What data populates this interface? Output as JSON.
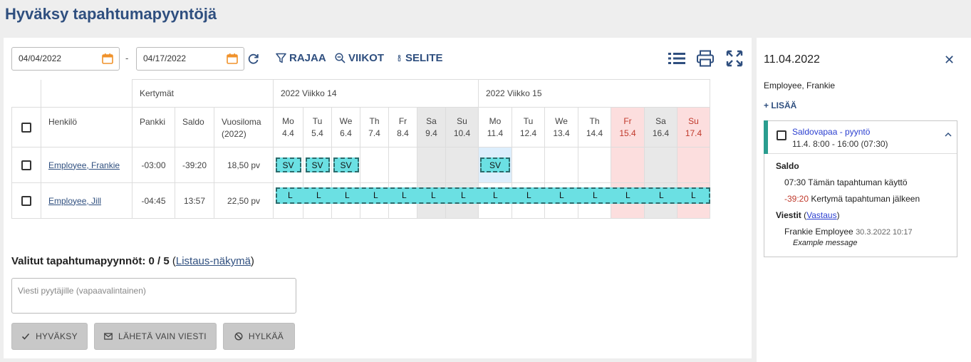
{
  "page": {
    "title": "Hyväksy tapahtumapyyntöjä"
  },
  "toolbar": {
    "date_from": "04/04/2022",
    "date_to": "04/17/2022",
    "separator": "-",
    "filter_label": "RAJAA",
    "weeks_label": "VIIKOT",
    "legend_label": "SELITE"
  },
  "grid": {
    "accruals_header": "Kertymät",
    "weeks": [
      "2022 Viikko 14",
      "2022 Viikko 15"
    ],
    "col_person": "Henkilö",
    "col_bank": "Pankki",
    "col_balance": "Saldo",
    "col_vacation": "Vuosiloma",
    "col_vacation_year": "(2022)",
    "days": [
      {
        "name": "Mo",
        "date": "4.4",
        "type": "weekday"
      },
      {
        "name": "Tu",
        "date": "5.4",
        "type": "weekday"
      },
      {
        "name": "We",
        "date": "6.4",
        "type": "weekday"
      },
      {
        "name": "Th",
        "date": "7.4",
        "type": "weekday"
      },
      {
        "name": "Fr",
        "date": "8.4",
        "type": "weekday"
      },
      {
        "name": "Sa",
        "date": "9.4",
        "type": "weekend"
      },
      {
        "name": "Su",
        "date": "10.4",
        "type": "weekend"
      },
      {
        "name": "Mo",
        "date": "11.4",
        "type": "weekday"
      },
      {
        "name": "Tu",
        "date": "12.4",
        "type": "weekday"
      },
      {
        "name": "We",
        "date": "13.4",
        "type": "weekday"
      },
      {
        "name": "Th",
        "date": "14.4",
        "type": "weekday"
      },
      {
        "name": "Fr",
        "date": "15.4",
        "type": "holiday"
      },
      {
        "name": "Sa",
        "date": "16.4",
        "type": "weekend"
      },
      {
        "name": "Su",
        "date": "17.4",
        "type": "holiday"
      }
    ],
    "rows": [
      {
        "name": "Employee, Frankie",
        "bank": "-03:00",
        "balance": "-39:20",
        "vacation": "18,50 pv",
        "event_code": "SV"
      },
      {
        "name": "Employee, Jill",
        "bank": "-04:45",
        "balance": "13:57",
        "vacation": "22,50 pv",
        "event_code": "L"
      }
    ]
  },
  "selection": {
    "label": "Valitut tapahtumapyynnöt:",
    "count": "0 / 5",
    "list_link": "Listaus-näkymä"
  },
  "message": {
    "placeholder": "Viesti pyytäjille (vapaavalintainen)"
  },
  "actions": {
    "approve": "HYVÄKSY",
    "send_message_only": "LÄHETÄ VAIN VIESTI",
    "reject": "HYLKÄÄ"
  },
  "side": {
    "date": "11.04.2022",
    "close": "✕",
    "employee": "Employee, Frankie",
    "add": "+ LISÄÄ",
    "card": {
      "title": "Saldovapaa - pyyntö",
      "time": "11.4. 8:00 - 16:00 (07:30)",
      "balance_heading": "Saldo",
      "usage_value": "07:30",
      "usage_label": "Tämän tapahtuman käyttö",
      "after_value": "-39:20",
      "after_label": "Kertymä tapahtuman jälkeen",
      "messages_heading": "Viestit",
      "reply_link": "Vastaus",
      "msg_author": "Frankie Employee",
      "msg_time": "30.3.2022 10:17",
      "msg_text": "Example message"
    }
  },
  "colors": {
    "accent": "#2f4f7f",
    "event": "#6be0e3",
    "weekend": "#e8e8e8",
    "holiday": "#fcdede",
    "negative": "#c0392b",
    "positive": "#2e8b3a"
  }
}
